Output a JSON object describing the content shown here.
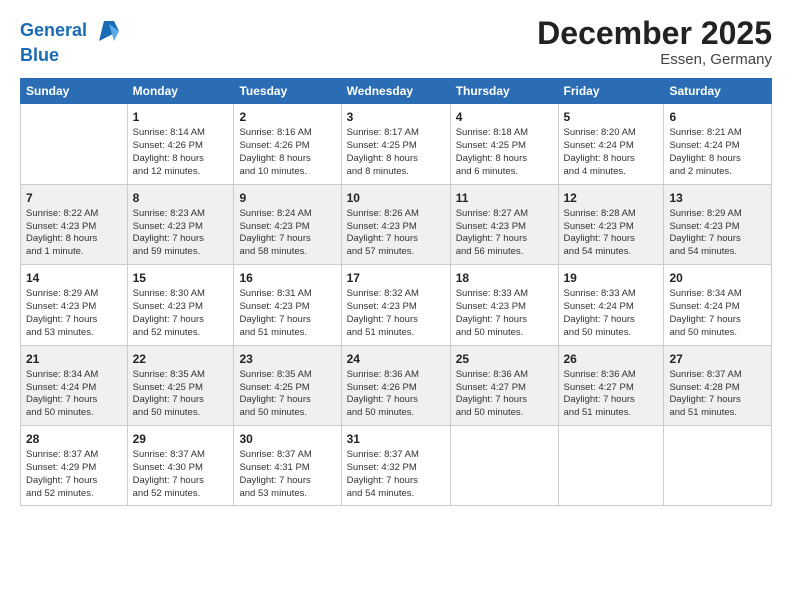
{
  "header": {
    "logo_line1": "General",
    "logo_line2": "Blue",
    "month": "December 2025",
    "location": "Essen, Germany"
  },
  "columns": [
    "Sunday",
    "Monday",
    "Tuesday",
    "Wednesday",
    "Thursday",
    "Friday",
    "Saturday"
  ],
  "weeks": [
    [
      {
        "day": "",
        "info": ""
      },
      {
        "day": "1",
        "info": "Sunrise: 8:14 AM\nSunset: 4:26 PM\nDaylight: 8 hours\nand 12 minutes."
      },
      {
        "day": "2",
        "info": "Sunrise: 8:16 AM\nSunset: 4:26 PM\nDaylight: 8 hours\nand 10 minutes."
      },
      {
        "day": "3",
        "info": "Sunrise: 8:17 AM\nSunset: 4:25 PM\nDaylight: 8 hours\nand 8 minutes."
      },
      {
        "day": "4",
        "info": "Sunrise: 8:18 AM\nSunset: 4:25 PM\nDaylight: 8 hours\nand 6 minutes."
      },
      {
        "day": "5",
        "info": "Sunrise: 8:20 AM\nSunset: 4:24 PM\nDaylight: 8 hours\nand 4 minutes."
      },
      {
        "day": "6",
        "info": "Sunrise: 8:21 AM\nSunset: 4:24 PM\nDaylight: 8 hours\nand 2 minutes."
      }
    ],
    [
      {
        "day": "7",
        "info": "Sunrise: 8:22 AM\nSunset: 4:23 PM\nDaylight: 8 hours\nand 1 minute."
      },
      {
        "day": "8",
        "info": "Sunrise: 8:23 AM\nSunset: 4:23 PM\nDaylight: 7 hours\nand 59 minutes."
      },
      {
        "day": "9",
        "info": "Sunrise: 8:24 AM\nSunset: 4:23 PM\nDaylight: 7 hours\nand 58 minutes."
      },
      {
        "day": "10",
        "info": "Sunrise: 8:26 AM\nSunset: 4:23 PM\nDaylight: 7 hours\nand 57 minutes."
      },
      {
        "day": "11",
        "info": "Sunrise: 8:27 AM\nSunset: 4:23 PM\nDaylight: 7 hours\nand 56 minutes."
      },
      {
        "day": "12",
        "info": "Sunrise: 8:28 AM\nSunset: 4:23 PM\nDaylight: 7 hours\nand 54 minutes."
      },
      {
        "day": "13",
        "info": "Sunrise: 8:29 AM\nSunset: 4:23 PM\nDaylight: 7 hours\nand 54 minutes."
      }
    ],
    [
      {
        "day": "14",
        "info": "Sunrise: 8:29 AM\nSunset: 4:23 PM\nDaylight: 7 hours\nand 53 minutes."
      },
      {
        "day": "15",
        "info": "Sunrise: 8:30 AM\nSunset: 4:23 PM\nDaylight: 7 hours\nand 52 minutes."
      },
      {
        "day": "16",
        "info": "Sunrise: 8:31 AM\nSunset: 4:23 PM\nDaylight: 7 hours\nand 51 minutes."
      },
      {
        "day": "17",
        "info": "Sunrise: 8:32 AM\nSunset: 4:23 PM\nDaylight: 7 hours\nand 51 minutes."
      },
      {
        "day": "18",
        "info": "Sunrise: 8:33 AM\nSunset: 4:23 PM\nDaylight: 7 hours\nand 50 minutes."
      },
      {
        "day": "19",
        "info": "Sunrise: 8:33 AM\nSunset: 4:24 PM\nDaylight: 7 hours\nand 50 minutes."
      },
      {
        "day": "20",
        "info": "Sunrise: 8:34 AM\nSunset: 4:24 PM\nDaylight: 7 hours\nand 50 minutes."
      }
    ],
    [
      {
        "day": "21",
        "info": "Sunrise: 8:34 AM\nSunset: 4:24 PM\nDaylight: 7 hours\nand 50 minutes."
      },
      {
        "day": "22",
        "info": "Sunrise: 8:35 AM\nSunset: 4:25 PM\nDaylight: 7 hours\nand 50 minutes."
      },
      {
        "day": "23",
        "info": "Sunrise: 8:35 AM\nSunset: 4:25 PM\nDaylight: 7 hours\nand 50 minutes."
      },
      {
        "day": "24",
        "info": "Sunrise: 8:36 AM\nSunset: 4:26 PM\nDaylight: 7 hours\nand 50 minutes."
      },
      {
        "day": "25",
        "info": "Sunrise: 8:36 AM\nSunset: 4:27 PM\nDaylight: 7 hours\nand 50 minutes."
      },
      {
        "day": "26",
        "info": "Sunrise: 8:36 AM\nSunset: 4:27 PM\nDaylight: 7 hours\nand 51 minutes."
      },
      {
        "day": "27",
        "info": "Sunrise: 8:37 AM\nSunset: 4:28 PM\nDaylight: 7 hours\nand 51 minutes."
      }
    ],
    [
      {
        "day": "28",
        "info": "Sunrise: 8:37 AM\nSunset: 4:29 PM\nDaylight: 7 hours\nand 52 minutes."
      },
      {
        "day": "29",
        "info": "Sunrise: 8:37 AM\nSunset: 4:30 PM\nDaylight: 7 hours\nand 52 minutes."
      },
      {
        "day": "30",
        "info": "Sunrise: 8:37 AM\nSunset: 4:31 PM\nDaylight: 7 hours\nand 53 minutes."
      },
      {
        "day": "31",
        "info": "Sunrise: 8:37 AM\nSunset: 4:32 PM\nDaylight: 7 hours\nand 54 minutes."
      },
      {
        "day": "",
        "info": ""
      },
      {
        "day": "",
        "info": ""
      },
      {
        "day": "",
        "info": ""
      }
    ]
  ]
}
